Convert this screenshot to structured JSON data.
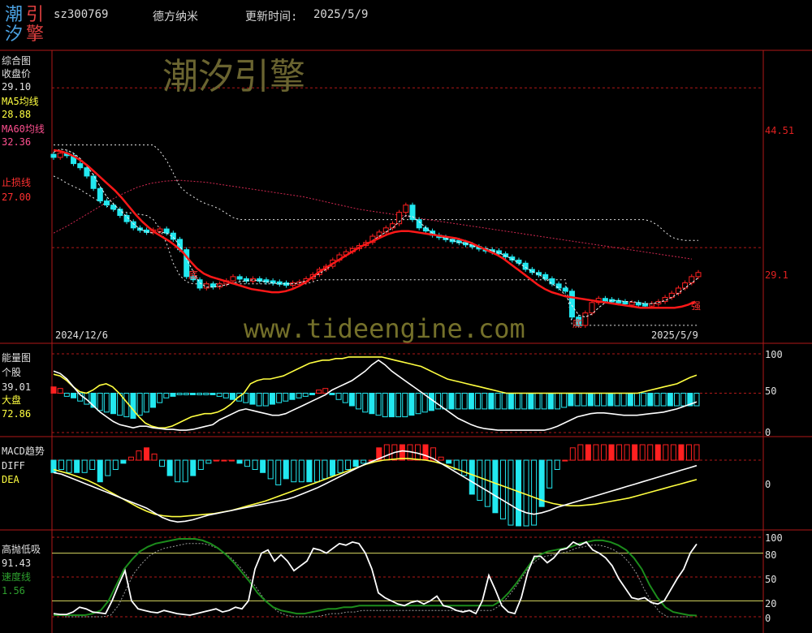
{
  "header": {
    "logo_chars": [
      "潮",
      "引",
      "汐",
      "擎"
    ],
    "code": "sz300769",
    "name": "德方纳米",
    "update_label": "更新时间:",
    "update_date": "2025/5/9"
  },
  "watermark": {
    "brand": "潮汐引擎",
    "url": "www.tideengine.com"
  },
  "panel1": {
    "title": "综合图",
    "close_label": "收盘价",
    "close_value": "29.10",
    "ma5_label": "MA5均线",
    "ma5_value": "28.88",
    "ma60_label": "MA60均线",
    "ma60_value": "32.36",
    "stop_label": "止损线",
    "stop_value": "27.00",
    "ytick_hi": "44.51",
    "ytick_lo": "29.1",
    "date_start": "2024/12/6",
    "date_end": "2025/5/9",
    "marker_bottom": "底",
    "marker_strong": "强"
  },
  "panel2": {
    "title": "能量图",
    "stock_label": "个股",
    "stock_value": "39.01",
    "market_label": "大盘",
    "market_value": "72.86",
    "yticks": [
      "100",
      "50",
      "0"
    ]
  },
  "panel3": {
    "title": "MACD趋势",
    "diff_label": "DIFF",
    "dea_label": "DEA",
    "yticks": [
      "0"
    ]
  },
  "panel4": {
    "title": "高抛低吸",
    "value": "91.43",
    "speed_label": "速度线",
    "speed_value": "1.56",
    "yticks": [
      "100",
      "80",
      "50",
      "20",
      "0"
    ]
  },
  "colors": {
    "up": "#ff2020",
    "down": "#22e8f0",
    "ma": "#ff1818",
    "yellow": "#ffff40",
    "green": "#1c8c1c",
    "grid": "#b01818"
  },
  "chart_data": [
    {
      "type": "candlestick",
      "title": "综合图",
      "x_start": "2024/12/6",
      "x_end": "2025/5/9",
      "close": [
        37.8,
        38.2,
        38.0,
        37.2,
        36.8,
        36.0,
        34.8,
        33.6,
        33.2,
        32.8,
        32.2,
        31.6,
        31.0,
        30.8,
        30.6,
        30.8,
        30.9,
        30.5,
        29.9,
        28.9,
        26.3,
        26.0,
        25.2,
        25.6,
        25.3,
        25.6,
        25.9,
        26.3,
        26.1,
        26.0,
        26.1,
        26.0,
        25.9,
        25.8,
        25.7,
        25.6,
        25.7,
        25.8,
        26.1,
        26.5,
        27.0,
        27.3,
        27.9,
        28.4,
        28.7,
        29.0,
        29.3,
        29.6,
        30.2,
        30.6,
        31.0,
        31.4,
        32.5,
        33.2,
        31.8,
        31.0,
        30.7,
        30.3,
        30.1,
        29.9,
        29.8,
        29.6,
        29.4,
        29.2,
        29.0,
        28.9,
        28.8,
        28.5,
        28.2,
        27.9,
        27.6,
        27.0,
        26.7,
        26.5,
        26.1,
        25.6,
        25.2,
        24.9,
        22.4,
        21.6,
        22.8,
        23.8,
        24.2,
        24.1,
        24.0,
        23.9,
        23.8,
        23.8,
        23.7,
        23.6,
        23.7,
        23.9,
        24.3,
        24.7,
        25.2,
        25.7,
        26.3,
        26.7
      ],
      "ma5": [
        38.3,
        38.6,
        38.5,
        38.2,
        37.7,
        37.0,
        36.1,
        35.0,
        34.0,
        33.3,
        32.7,
        32.1,
        31.4,
        30.9,
        30.6,
        30.5,
        30.6,
        30.5,
        30.1,
        29.3,
        28.0,
        26.8,
        25.7,
        25.3,
        25.3,
        25.4,
        25.5,
        25.7,
        25.8,
        25.9,
        26.0,
        25.9,
        25.8,
        25.7,
        25.6,
        25.6,
        25.6,
        25.7,
        25.9,
        26.2,
        26.6,
        27.0,
        27.5,
        28.0,
        28.4,
        28.8,
        29.1,
        29.4,
        29.8,
        30.2,
        30.6,
        31.0,
        31.6,
        32.2,
        32.1,
        31.6,
        31.0,
        30.5,
        30.2,
        30.0,
        29.8,
        29.6,
        29.5,
        29.3,
        29.1,
        29.0,
        28.8,
        28.6,
        28.3,
        28.0,
        27.6,
        27.2,
        26.8,
        26.5,
        26.1,
        25.6,
        25.2,
        24.5,
        23.5,
        22.6,
        22.4,
        22.7,
        23.3,
        23.8,
        24.0,
        24.0,
        23.9,
        23.9,
        23.8,
        23.7,
        23.7,
        23.8,
        24.0,
        24.3,
        24.7,
        25.2,
        25.7,
        26.2
      ],
      "ma_red": [
        38.5,
        38.4,
        38.2,
        37.9,
        37.5,
        37.0,
        36.4,
        35.8,
        35.2,
        34.6,
        33.9,
        33.1,
        32.3,
        31.6,
        31.0,
        30.5,
        30.1,
        29.7,
        29.2,
        28.6,
        27.8,
        27.1,
        26.6,
        26.3,
        26.1,
        25.9,
        25.7,
        25.5,
        25.3,
        25.1,
        25.0,
        24.9,
        24.8,
        24.8,
        24.9,
        25.1,
        25.4,
        25.8,
        26.3,
        26.8,
        27.2,
        27.6,
        28.0,
        28.4,
        28.8,
        29.2,
        29.5,
        29.8,
        30.1,
        30.4,
        30.6,
        30.7,
        30.7,
        30.6,
        30.5,
        30.4,
        30.3,
        30.2,
        30.1,
        30.0,
        29.8,
        29.6,
        29.3,
        29.0,
        28.7,
        28.4,
        28.0,
        27.5,
        27.0,
        26.5,
        26.0,
        25.5,
        25.1,
        24.8,
        24.6,
        24.4,
        24.3,
        24.2,
        24.1,
        24.0,
        23.9,
        23.8,
        23.7,
        23.6,
        23.5,
        23.4,
        23.3,
        23.3,
        23.3,
        23.3,
        23.3,
        23.3,
        23.4,
        23.6,
        23.9
      ],
      "ma60": [
        30.5,
        31.2,
        32.0,
        32.8,
        33.6,
        34.3,
        34.9,
        35.3,
        35.5,
        35.6,
        35.5,
        35.4,
        35.2,
        35.0,
        34.8,
        34.6,
        34.4,
        34.2,
        34.0,
        33.7,
        33.4,
        33.1,
        32.8,
        32.6,
        32.4,
        32.2,
        32.0,
        31.8,
        31.6,
        31.4,
        31.2,
        31.0,
        30.8,
        30.6,
        30.4,
        30.2,
        30.0,
        29.8,
        29.6,
        29.4,
        29.2,
        29.0,
        28.8,
        28.6,
        28.4,
        28.2,
        28.0
      ],
      "stop_upper": [
        39.0,
        39.0,
        39.0,
        39.0,
        39.0,
        39.0,
        39.0,
        39.0,
        39.0,
        39.0,
        39.0,
        39.0,
        39.0,
        39.0,
        39.0,
        39.0,
        38.4,
        37.5,
        36.3,
        35.0,
        34.4,
        34.0,
        33.6,
        33.3,
        33.1,
        32.8,
        32.4,
        32.0,
        31.8,
        31.8,
        31.8,
        31.8,
        31.8,
        31.8,
        31.8,
        31.8,
        31.8,
        31.8,
        31.8,
        31.8,
        31.8,
        31.8,
        31.8,
        31.8,
        31.8,
        31.8,
        31.8,
        31.8,
        31.8,
        31.8,
        31.8,
        31.8,
        31.8,
        31.8,
        31.8,
        31.8,
        31.8,
        31.8,
        31.8,
        31.8,
        31.8,
        31.8,
        31.8,
        31.8,
        31.8,
        31.8,
        31.8,
        31.8,
        31.8,
        31.8,
        31.8,
        31.8,
        31.8,
        31.8,
        31.8,
        31.8,
        31.8,
        31.8,
        31.8,
        31.8,
        31.8,
        31.8,
        31.8,
        31.8,
        31.8,
        31.8,
        31.8,
        31.8,
        31.8,
        31.8,
        31.6,
        31.2,
        30.6,
        30.1,
        29.9,
        29.8,
        29.8,
        29.8
      ],
      "stop_lower": [
        36.0,
        35.7,
        35.3,
        35.0,
        34.7,
        34.3,
        33.9,
        33.5,
        33.1,
        32.8,
        32.6,
        32.5,
        32.4,
        32.3,
        32.2,
        31.8,
        30.9,
        29.5,
        27.6,
        26.4,
        25.8,
        25.6,
        25.6,
        25.6,
        25.6,
        25.6,
        25.6,
        25.6,
        25.6,
        25.6,
        25.6,
        25.6,
        25.6,
        25.6,
        25.6,
        25.6,
        25.6,
        25.6,
        25.6,
        25.8,
        26.0,
        26.0,
        26.0,
        26.0,
        26.0,
        26.0,
        26.0,
        26.0,
        26.0,
        26.0,
        26.0,
        26.0,
        26.0,
        26.0,
        26.0,
        26.0,
        26.0,
        26.0,
        26.0,
        26.0,
        26.0,
        26.0,
        26.0,
        26.0,
        26.0,
        26.0,
        26.0,
        26.0,
        26.0,
        26.0,
        26.0,
        26.0,
        26.0,
        26.0,
        26.0,
        26.0,
        26.0,
        26.0,
        21.6,
        21.6,
        21.6,
        21.6,
        21.6,
        21.6,
        21.6,
        21.6,
        21.6,
        21.6,
        21.6,
        21.6,
        21.6,
        21.6,
        21.6,
        21.6,
        21.6,
        21.6,
        21.6,
        21.6
      ],
      "hlines": [
        44.51,
        29.1
      ],
      "ylim": [
        20.5,
        47.5
      ]
    },
    {
      "type": "bar+line",
      "title": "能量图",
      "stock": [
        78,
        75,
        68,
        58,
        48,
        42,
        34,
        26,
        20,
        14,
        10,
        8,
        6,
        8,
        8,
        6,
        5,
        4,
        4,
        3,
        3,
        4,
        6,
        8,
        10,
        16,
        20,
        24,
        28,
        30,
        28,
        26,
        24,
        22,
        22,
        24,
        28,
        32,
        36,
        40,
        44,
        48,
        54,
        58,
        62,
        66,
        72,
        78,
        86,
        92,
        86,
        78,
        72,
        66,
        60,
        54,
        48,
        42,
        36,
        30,
        24,
        18,
        14,
        10,
        7,
        5,
        4,
        3,
        3,
        3,
        3,
        3,
        3,
        3,
        3,
        5,
        8,
        12,
        16,
        20,
        22,
        24,
        25,
        25,
        24,
        23,
        22,
        22,
        22,
        23,
        24,
        25,
        26,
        28,
        30,
        33,
        36,
        39
      ],
      "market": [
        74,
        72,
        66,
        58,
        52,
        50,
        54,
        60,
        62,
        58,
        50,
        40,
        30,
        20,
        12,
        8,
        6,
        6,
        8,
        12,
        16,
        20,
        22,
        24,
        24,
        26,
        30,
        36,
        44,
        50,
        62,
        66,
        68,
        68,
        70,
        72,
        76,
        80,
        84,
        88,
        90,
        92,
        92,
        94,
        94,
        96,
        96,
        96,
        96,
        96,
        96,
        94,
        92,
        90,
        88,
        86,
        84,
        80,
        76,
        72,
        68,
        66,
        64,
        62,
        60,
        58,
        56,
        54,
        52,
        50,
        50,
        50,
        50,
        50,
        50,
        50,
        50,
        50,
        50,
        50,
        50,
        50,
        50,
        50,
        50,
        50,
        50,
        50,
        50,
        50,
        52,
        54,
        56,
        58,
        60,
        62,
        66,
        70,
        72.86
      ],
      "bars": [
        8,
        6,
        -4,
        -6,
        -10,
        -14,
        -18,
        -22,
        -24,
        -26,
        -28,
        -30,
        -32,
        -28,
        -24,
        -18,
        -12,
        -6,
        -4,
        -2,
        -2,
        -2,
        -2,
        -2,
        -2,
        -4,
        -6,
        -8,
        -10,
        -12,
        -14,
        -16,
        -16,
        -14,
        -12,
        -10,
        -8,
        -6,
        -4,
        -2,
        4,
        6,
        -2,
        -8,
        -12,
        -16,
        -20,
        -24,
        -26,
        -28,
        -30,
        -30,
        -30,
        -30,
        -28,
        -26,
        -24,
        -22,
        -20,
        -20,
        -20,
        -20,
        -20,
        -20,
        -20,
        -20,
        -20,
        -20,
        -20,
        -20,
        -20,
        -20,
        -20,
        -20,
        -20,
        -20,
        -20,
        -18,
        -16,
        -16,
        -16,
        -16,
        -16,
        -16,
        -16,
        -16,
        -16,
        -16,
        -16,
        -16,
        -16,
        -16,
        -16,
        -16,
        -16,
        -16,
        -16,
        -16
      ],
      "ylim": [
        0,
        100
      ]
    },
    {
      "type": "macd",
      "title": "MACD趋势",
      "diff": [
        -1.6,
        -1.8,
        -2.2,
        -2.6,
        -3.0,
        -3.4,
        -3.8,
        -4.2,
        -4.6,
        -5.0,
        -5.4,
        -5.8,
        -6.2,
        -6.8,
        -7.4,
        -7.8,
        -8.0,
        -7.9,
        -7.7,
        -7.4,
        -7.1,
        -6.9,
        -6.7,
        -6.5,
        -6.3,
        -6.1,
        -5.9,
        -5.7,
        -5.5,
        -5.3,
        -5.1,
        -4.8,
        -4.4,
        -4.0,
        -3.6,
        -3.1,
        -2.6,
        -2.1,
        -1.6,
        -1.1,
        -0.6,
        -0.2,
        0.2,
        0.6,
        1.0,
        1.2,
        1.1,
        0.9,
        0.6,
        0.2,
        -0.4,
        -1.0,
        -1.6,
        -2.2,
        -2.8,
        -3.4,
        -4.0,
        -4.6,
        -5.2,
        -5.8,
        -6.4,
        -6.8,
        -7.0,
        -6.8,
        -6.5,
        -6.1,
        -5.8,
        -5.5,
        -5.2,
        -4.9,
        -4.6,
        -4.3,
        -4.0,
        -3.7,
        -3.4,
        -3.1,
        -2.8,
        -2.5,
        -2.2,
        -1.9,
        -1.6,
        -1.3,
        -1.0,
        -0.7
      ],
      "dea": [
        -1.2,
        -1.5,
        -1.8,
        -2.2,
        -2.6,
        -3.1,
        -3.7,
        -4.3,
        -4.9,
        -5.5,
        -6.1,
        -6.6,
        -7.0,
        -7.2,
        -7.3,
        -7.3,
        -7.2,
        -7.1,
        -7.0,
        -6.9,
        -6.7,
        -6.5,
        -6.2,
        -5.9,
        -5.6,
        -5.3,
        -4.9,
        -4.5,
        -4.1,
        -3.7,
        -3.3,
        -2.9,
        -2.5,
        -2.1,
        -1.7,
        -1.3,
        -0.9,
        -0.5,
        -0.2,
        0.0,
        0.1,
        0.2,
        0.2,
        0.1,
        0.0,
        -0.2,
        -0.5,
        -0.9,
        -1.3,
        -1.7,
        -2.1,
        -2.5,
        -2.9,
        -3.3,
        -3.7,
        -4.1,
        -4.5,
        -4.9,
        -5.3,
        -5.6,
        -5.8,
        -5.9,
        -5.9,
        -5.8,
        -5.7,
        -5.5,
        -5.3,
        -5.1,
        -4.9,
        -4.6,
        -4.3,
        -4.0,
        -3.7,
        -3.4,
        -3.1,
        -2.8,
        -2.5
      ],
      "ylim": [
        -8.5,
        2.0
      ]
    },
    {
      "type": "line",
      "title": "高抛低吸",
      "value": [
        4,
        3,
        3,
        6,
        12,
        10,
        6,
        5,
        4,
        20,
        40,
        58,
        20,
        10,
        8,
        6,
        5,
        8,
        6,
        4,
        3,
        2,
        4,
        6,
        8,
        10,
        6,
        8,
        12,
        10,
        20,
        60,
        80,
        84,
        70,
        78,
        70,
        58,
        64,
        70,
        86,
        84,
        80,
        86,
        92,
        90,
        94,
        92,
        80,
        60,
        30,
        24,
        20,
        16,
        14,
        18,
        20,
        16,
        20,
        26,
        14,
        12,
        8,
        6,
        8,
        4,
        20,
        52,
        34,
        14,
        6,
        4,
        24,
        56,
        76,
        76,
        68,
        74,
        84,
        86,
        94,
        90,
        94,
        84,
        80,
        74,
        64,
        48,
        36,
        24,
        22,
        24,
        18,
        16,
        20,
        34,
        48,
        60,
        80,
        91.43
      ],
      "speed": [
        2,
        2,
        2,
        2,
        2,
        4,
        8,
        20,
        40,
        60,
        72,
        82,
        88,
        92,
        94,
        96,
        98,
        98,
        98,
        96,
        92,
        86,
        78,
        68,
        56,
        44,
        30,
        20,
        12,
        8,
        6,
        4,
        4,
        6,
        8,
        10,
        10,
        12,
        12,
        14,
        14,
        14,
        14,
        14,
        14,
        14,
        14,
        14,
        14,
        14,
        14,
        14,
        14,
        14,
        14,
        14,
        14,
        20,
        30,
        42,
        56,
        70,
        78,
        82,
        84,
        86,
        88,
        92,
        94,
        96,
        96,
        94,
        90,
        84,
        74,
        60,
        40,
        24,
        12,
        6,
        4,
        2,
        1.56
      ],
      "hlines": [
        100,
        80,
        50,
        20,
        0
      ],
      "ylim": [
        0,
        100
      ]
    }
  ]
}
